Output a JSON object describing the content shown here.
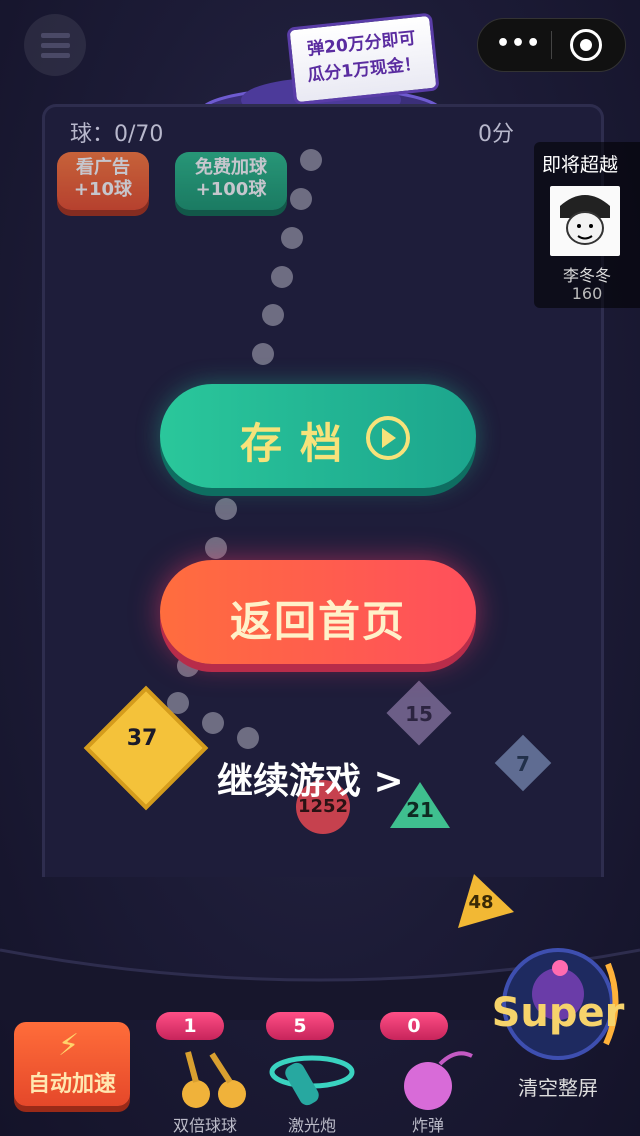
{
  "header": {
    "menu_icon": "hamburger-icon",
    "capsule_more": "•••",
    "capsule_icon": "record-icon"
  },
  "promo": {
    "line1": "弹20万分即可",
    "line2": "瓜分1万现金！"
  },
  "stats": {
    "balls": "球：0/70",
    "score": "0分"
  },
  "buttons": {
    "ad": {
      "line1": "看广告",
      "line2": "+10球"
    },
    "free": {
      "line1": "免费加球",
      "line2": "+100球"
    }
  },
  "overtake": {
    "title": "即将超越",
    "name": "李冬冬",
    "score": "160"
  },
  "dialog": {
    "save_label": "存档",
    "home_label": "返回首页",
    "continue_label": "继续游戏 >"
  },
  "board": {
    "shapes": [
      {
        "id": "diamond-37",
        "value": "37"
      },
      {
        "id": "diamond-15",
        "value": "15"
      },
      {
        "id": "diamond-7",
        "value": "7"
      },
      {
        "id": "circle-1252",
        "value": "1252"
      },
      {
        "id": "triangle-21",
        "value": "21"
      },
      {
        "id": "triangle-48",
        "value": "48"
      }
    ]
  },
  "tools": {
    "auto": {
      "label": "自动加速",
      "icon": "lightning-icon"
    },
    "double": {
      "count": "1",
      "label": "双倍球球"
    },
    "laser": {
      "count": "5",
      "label": "激光炮"
    },
    "bomb": {
      "count": "0",
      "label": "炸弹"
    },
    "super": {
      "badge": "Super",
      "label": "清空整屏"
    }
  },
  "colors": {
    "save": "#2ac79b",
    "home": "#ff5a4e",
    "auto": "#ff6d3a",
    "badge": "#e8336e"
  }
}
